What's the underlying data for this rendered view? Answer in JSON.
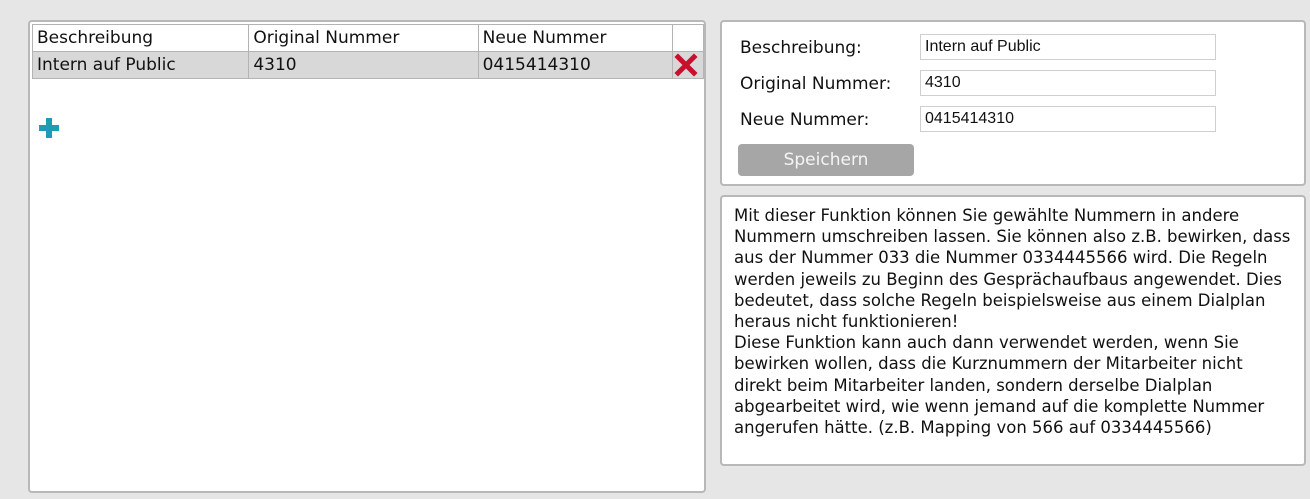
{
  "table": {
    "headers": [
      "Beschreibung",
      "Original Nummer",
      "Neue Nummer"
    ],
    "rows": [
      {
        "description": "Intern auf Public",
        "original": "4310",
        "new": "0415414310"
      }
    ]
  },
  "form": {
    "description_label": "Beschreibung:",
    "description_value": "Intern auf Public",
    "original_label": "Original Nummer:",
    "original_value": "4310",
    "new_label": "Neue Nummer:",
    "new_value": "0415414310",
    "save_label": "Speichern"
  },
  "help": {
    "paragraph1": "Mit dieser Funktion können Sie gewählte Nummern in andere Nummern umschreiben lassen. Sie können also z.B. bewirken, dass aus der Nummer 033 die Nummer 0334445566 wird. Die Regeln werden jeweils zu Beginn des Gesprächaufbaus angewendet. Dies bedeutet, dass solche Regeln beispielsweise aus einem Dialplan heraus nicht funktionieren!",
    "paragraph2": "Diese Funktion kann auch dann verwendet werden, wenn Sie bewirken wollen, dass die Kurznummern der Mitarbeiter nicht direkt beim Mitarbeiter landen, sondern derselbe Dialplan abgearbeitet wird, wie wenn jemand auf die komplette Nummer angerufen hätte. (z.B. Mapping von 566 auf 0334445566)"
  },
  "icons": {
    "delete": "close-icon",
    "add": "plus-icon"
  },
  "colors": {
    "delete": "#c8102e",
    "add": "#1f9bb5",
    "button": "#a6a6a6",
    "selected_row": "#d8d8d8"
  }
}
